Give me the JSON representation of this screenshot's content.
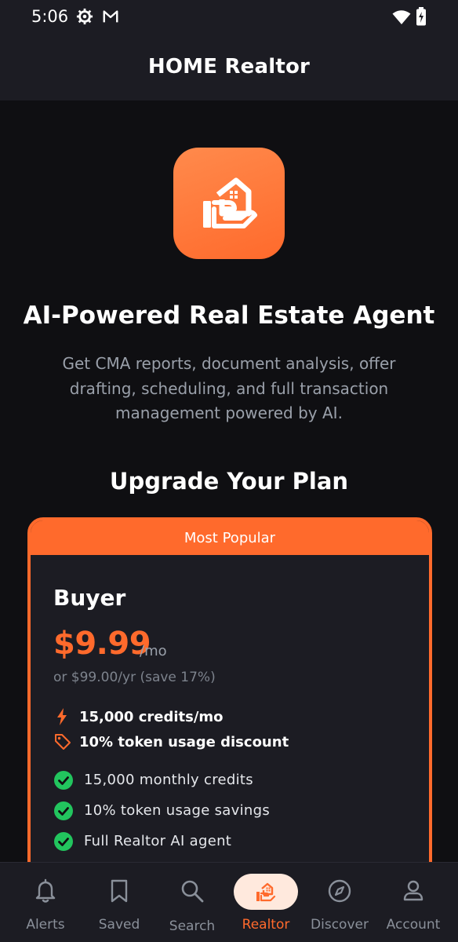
{
  "status_bar": {
    "time": "5:06"
  },
  "header": {
    "title": "HOME Realtor"
  },
  "hero": {
    "title": "AI-Powered Real Estate Agent",
    "description": "Get CMA reports, document analysis, offer drafting, scheduling, and full transaction management powered by AI."
  },
  "plans_section": {
    "title": "Upgrade Your Plan"
  },
  "plan": {
    "ribbon": "Most Popular",
    "name": "Buyer",
    "price": "$9.99",
    "price_unit": "/mo",
    "price_alt": "or $99.00/yr (save 17%)",
    "highlights": [
      {
        "icon": "lightning-icon",
        "label": "15,000 credits/mo"
      },
      {
        "icon": "tag-icon",
        "label": "10% token usage discount"
      }
    ],
    "features": [
      "15,000 monthly credits",
      "10% token usage savings",
      "Full Realtor AI agent"
    ]
  },
  "bottom_nav": {
    "items": [
      {
        "label": "Alerts",
        "icon": "bell-icon"
      },
      {
        "label": "Saved",
        "icon": "bookmark-icon"
      },
      {
        "label": "Search",
        "icon": "search-icon"
      },
      {
        "label": "Realtor",
        "icon": "realtor-house-icon"
      },
      {
        "label": "Discover",
        "icon": "compass-icon"
      },
      {
        "label": "Account",
        "icon": "person-icon"
      }
    ],
    "active": "Realtor"
  },
  "colors": {
    "accent": "#ff6a2c",
    "background": "#0f0f12",
    "surface": "#1c1c23",
    "check_green": "#22c55e"
  }
}
